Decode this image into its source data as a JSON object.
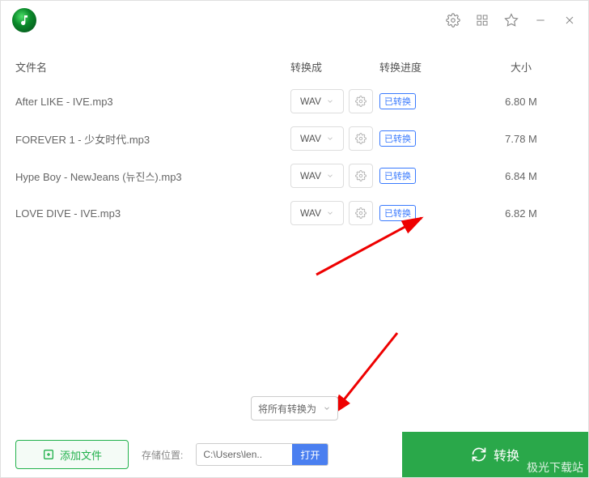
{
  "header": {
    "col_name": "文件名",
    "col_format": "转换成",
    "col_progress": "转换进度",
    "col_size": "大小"
  },
  "files": [
    {
      "name": "After LIKE - IVE.mp3",
      "format": "WAV",
      "status": "已转换",
      "size": "6.80 M"
    },
    {
      "name": "FOREVER 1 - 少女时代.mp3",
      "format": "WAV",
      "status": "已转换",
      "size": "7.78 M"
    },
    {
      "name": "Hype Boy - NewJeans (뉴진스).mp3",
      "format": "WAV",
      "status": "已转换",
      "size": "6.84 M"
    },
    {
      "name": "LOVE DIVE - IVE.mp3",
      "format": "WAV",
      "status": "已转换",
      "size": "6.82 M"
    }
  ],
  "convert_all": {
    "label": "将所有转换为"
  },
  "footer": {
    "add_file": "添加文件",
    "storage_label": "存储位置:",
    "path_value": "C:\\Users\\len..",
    "open_label": "打开",
    "convert_label": "转换",
    "watermark": "极光下载站"
  }
}
